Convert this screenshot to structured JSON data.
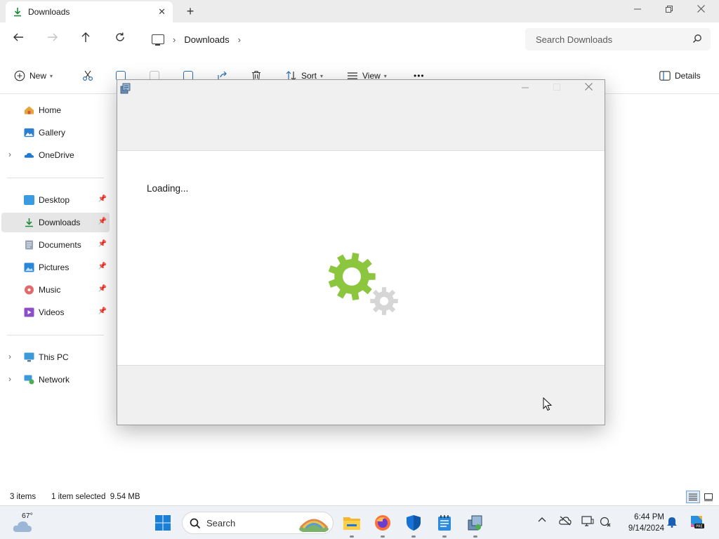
{
  "window": {
    "tab_title": "Downloads",
    "new_tab_symbol": "+",
    "close_tab_symbol": "✕"
  },
  "address": {
    "breadcrumb": "Downloads",
    "search_placeholder": "Search Downloads"
  },
  "commands": {
    "new": "New",
    "sort": "Sort",
    "view": "View",
    "more": "•••",
    "details": "Details"
  },
  "sidebar": {
    "quick": [
      {
        "label": "Home",
        "icon": "home-icon"
      },
      {
        "label": "Gallery",
        "icon": "gallery-icon"
      },
      {
        "label": "OneDrive",
        "icon": "onedrive-icon"
      }
    ],
    "pinned": [
      {
        "label": "Desktop",
        "icon": "desktop-folder-icon"
      },
      {
        "label": "Downloads",
        "icon": "downloads-folder-icon"
      },
      {
        "label": "Documents",
        "icon": "documents-folder-icon"
      },
      {
        "label": "Pictures",
        "icon": "pictures-folder-icon"
      },
      {
        "label": "Music",
        "icon": "music-folder-icon"
      },
      {
        "label": "Videos",
        "icon": "videos-folder-icon"
      }
    ],
    "devices": [
      {
        "label": "This PC",
        "icon": "this-pc-icon"
      },
      {
        "label": "Network",
        "icon": "network-icon"
      }
    ]
  },
  "status": {
    "items": "3 items",
    "selection": "1 item selected  9.54 MB"
  },
  "dialog": {
    "loading_text": "Loading...",
    "gear_primary_color": "#8cc63f",
    "gear_secondary_color": "#d6d6d6"
  },
  "taskbar": {
    "weather_temp": "67°",
    "search_label": "Search",
    "time": "6:44 PM",
    "date": "9/14/2024"
  },
  "colors": {
    "accent": "#0067c0",
    "selection": "#e6e6e6"
  }
}
